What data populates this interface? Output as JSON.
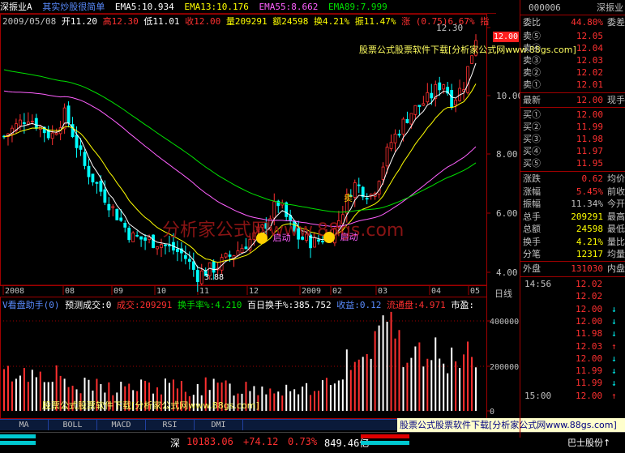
{
  "title_bar": {
    "name": "深振业A",
    "formula": "其实炒股很简单",
    "ema5": "EMA5:10.934",
    "ema13": "EMA13:10.176",
    "ema55": "EMA55:8.662",
    "ema89": "EMA89:7.999",
    "arrow": "↑"
  },
  "quote_line": {
    "date": "2009/05/08",
    "open": "开11.20",
    "high": "高12.30",
    "low": "低11.01",
    "close": "收12.00",
    "volume": "量209291",
    "amount": "额24598",
    "turnover": "换4.21%",
    "amplitude": "振11.47%",
    "change": "涨 (0.75)6.67%",
    "indicator": "指"
  },
  "price_axis": [
    "12.30",
    "10.00",
    "8.00",
    "6.00",
    "4.00"
  ],
  "current_price_tag": "12.00",
  "low_label": "3.88",
  "watermark_top": "股票公式股票软件下载[分析家公式网www.88gs.com]",
  "watermark_big": "分析家公式网www.88gs.com",
  "watermark_bottom": "股票公式股票软件下载[分析家公式网www.88gs.com]",
  "buy_signal_text": "启动",
  "sell_text": "卖",
  "time_axis": [
    "2008",
    "08",
    "09",
    "10",
    "11",
    "12",
    "2009",
    "02",
    "03",
    "04",
    "05"
  ],
  "right_axis_label": "日线",
  "lower_panel": {
    "title": "V看盘助手(0)",
    "forecast": "预测成交:0",
    "volume_label": "成交:209291",
    "turnover_label": "换手率%:4.210",
    "hundred_day": "百日换手%:385.752",
    "proceeds": "收益:0.12",
    "float": "流通盘:4.971",
    "market": "市盈:"
  },
  "volume_axis": [
    "400000",
    "200000",
    "0"
  ],
  "tabs": [
    "MA",
    "BOLL",
    "MACD",
    "RSI",
    "DMI"
  ],
  "ad_banner": "股票公式股票软件下载[分析家公式网www.88gs.com]",
  "status": {
    "market": "深",
    "index": "10183.06",
    "change": "+74.12",
    "pct": "0.73%",
    "amount": "849.46亿",
    "broker": "巴士股份↑"
  },
  "right_panel": {
    "code": "000006",
    "name": "深振业",
    "ratio_label": "委比",
    "ratio": "44.80%",
    "diff_label": "委差",
    "asks": [
      {
        "label": "卖⑤",
        "price": "12.05",
        "vol": ""
      },
      {
        "label": "卖④",
        "price": "12.04",
        "vol": ""
      },
      {
        "label": "卖③",
        "price": "12.03",
        "vol": ""
      },
      {
        "label": "卖②",
        "price": "12.02",
        "vol": ""
      },
      {
        "label": "卖①",
        "price": "12.01",
        "vol": ""
      }
    ],
    "last_label": "最新",
    "last": "12.00",
    "last_hand_label": "现手",
    "bids": [
      {
        "label": "买①",
        "price": "12.00"
      },
      {
        "label": "买②",
        "price": "11.99"
      },
      {
        "label": "买③",
        "price": "11.98"
      },
      {
        "label": "买④",
        "price": "11.97"
      },
      {
        "label": "买⑤",
        "price": "11.95"
      }
    ],
    "stats": [
      {
        "label": "涨跌",
        "val": "0.62",
        "label2": "均价",
        "color": "#ff3030"
      },
      {
        "label": "涨幅",
        "val": "5.45%",
        "label2": "前收",
        "color": "#ff3030"
      },
      {
        "label": "振幅",
        "val": "11.34%",
        "label2": "今开",
        "color": "#c0c0c0"
      },
      {
        "label": "总手",
        "val": "209291",
        "label2": "最高",
        "color": "#ffff00"
      },
      {
        "label": "总额",
        "val": "24598",
        "label2": "最低",
        "color": "#ffff00"
      },
      {
        "label": "换手",
        "val": "4.21%",
        "label2": "量比",
        "color": "#ffff00"
      },
      {
        "label": "分笔",
        "val": "12317",
        "label2": "均量",
        "color": "#ffff00"
      }
    ],
    "outer_label": "外盘",
    "outer": "131030",
    "inner_label": "内盘",
    "ticks": [
      {
        "t": "14:56",
        "p": "12.02",
        "a": "",
        "c": "#ff3030"
      },
      {
        "t": "",
        "p": "12.02",
        "a": "",
        "c": "#ff3030"
      },
      {
        "t": "",
        "p": "12.00",
        "a": "↓",
        "c": "#ff3030"
      },
      {
        "t": "",
        "p": "12.00",
        "a": "↓",
        "c": "#ff3030"
      },
      {
        "t": "",
        "p": "11.98",
        "a": "↓",
        "c": "#ff3030"
      },
      {
        "t": "",
        "p": "12.03",
        "a": "↑",
        "c": "#ff3030"
      },
      {
        "t": "",
        "p": "12.00",
        "a": "↓",
        "c": "#ff3030"
      },
      {
        "t": "",
        "p": "11.99",
        "a": "↓",
        "c": "#ff3030"
      },
      {
        "t": "",
        "p": "11.99",
        "a": "↓",
        "c": "#ff3030"
      },
      {
        "t": "15:00",
        "p": "12.00",
        "a": "↑",
        "c": "#ff3030"
      }
    ]
  },
  "colors": {
    "up": "#ff3030",
    "down": "#00ffff",
    "ema5": "#ffffff",
    "ema13": "#ffff00",
    "ema55": "#ff60ff",
    "ema89": "#00e000",
    "axis": "#a00000"
  }
}
